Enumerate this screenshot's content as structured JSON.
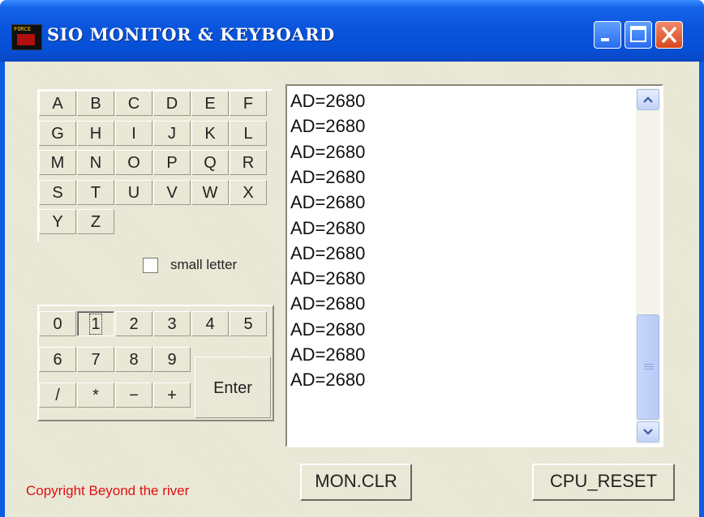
{
  "window": {
    "title": "SIO MONITOR & KEYBOARD",
    "icon_text": "FORCE"
  },
  "colors": {
    "titlebar": "#0a55dc",
    "client_bg": "#ecead8",
    "copyright_text": "#e01010",
    "scroll_thumb": "#c8d6fa"
  },
  "title_buttons": [
    {
      "name": "minimize-button",
      "icon": "minimize-icon"
    },
    {
      "name": "maximize-button",
      "icon": "maximize-icon"
    },
    {
      "name": "close-button",
      "icon": "close-icon"
    }
  ],
  "letter_keys": [
    [
      "A",
      "B",
      "C",
      "D",
      "E",
      "F"
    ],
    [
      "G",
      "H",
      "I",
      "J",
      "K",
      "L"
    ],
    [
      "M",
      "N",
      "O",
      "P",
      "Q",
      "R"
    ],
    [
      "S",
      "T",
      "U",
      "V",
      "W",
      "X"
    ],
    [
      "Y",
      "Z"
    ]
  ],
  "small_letter": {
    "label": "small letter",
    "checked": false
  },
  "number_keys": [
    [
      "0",
      "1",
      "2",
      "3",
      "4",
      "5"
    ],
    [
      "6",
      "7",
      "8",
      "9"
    ],
    [
      "/",
      "*",
      "−",
      "+"
    ]
  ],
  "focused_key": "1",
  "enter_label": "Enter",
  "monitor_lines": [
    "AD=2680",
    "AD=2680",
    "AD=2680",
    "AD=2680",
    "AD=2680",
    "AD=2680",
    "AD=2680",
    "AD=2680",
    "AD=2680",
    "AD=2680",
    "AD=2680",
    "AD=2680"
  ],
  "scroll": {
    "up_icon": "chevron-up-icon",
    "down_icon": "chevron-down-icon",
    "position": 0.7
  },
  "buttons": {
    "mon_clr": "MON.CLR",
    "cpu_reset": "CPU_RESET"
  },
  "copyright": "Copyright Beyond the river"
}
